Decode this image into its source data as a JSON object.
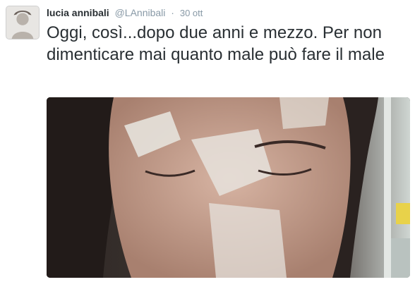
{
  "tweet": {
    "author_name": "lucia annibali",
    "author_handle": "@LAnnibali",
    "separator": "·",
    "timestamp": "30 ott",
    "text": "Oggi, così...dopo due anni e mezzo. Per non dimenticare mai quanto male può fare il male"
  },
  "avatar": {
    "icon": "user-avatar-photo"
  },
  "media": {
    "icon": "attached-photo",
    "colors": {
      "background": "#3a3330",
      "skin": "#c9a493",
      "hair": "#2a2220",
      "bandage": "#e6e2dc"
    }
  }
}
